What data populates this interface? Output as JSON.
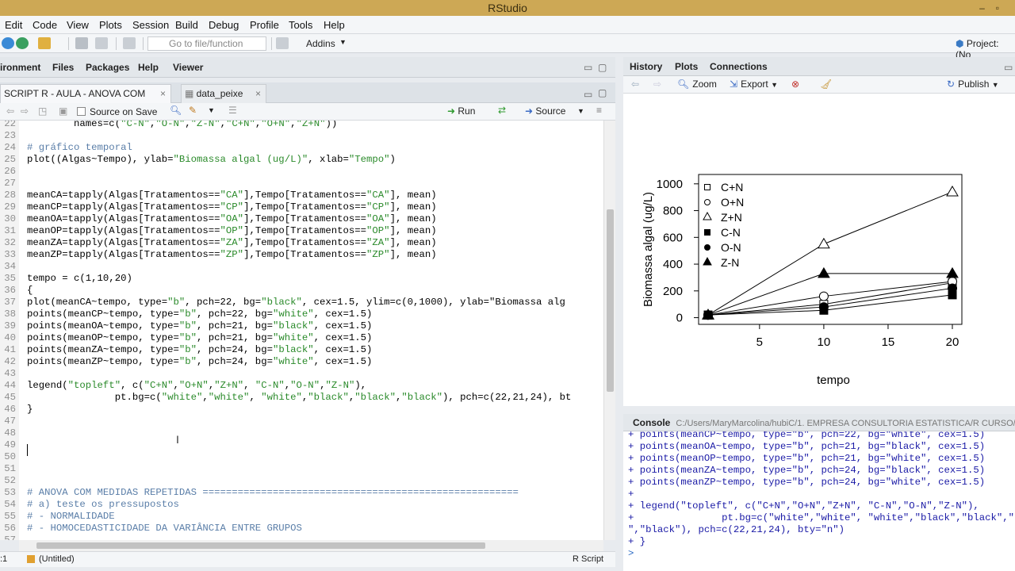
{
  "window": {
    "title": "RStudio"
  },
  "menu": [
    "Edit",
    "Code",
    "View",
    "Plots",
    "Session",
    "Build",
    "Debug",
    "Profile",
    "Tools",
    "Help"
  ],
  "toolbar": {
    "goto_placeholder": "Go to file/function",
    "addins": "Addins",
    "project": "Project: (No"
  },
  "left_pane_tabs": [
    "ironment",
    "Files",
    "Packages",
    "Help",
    "Viewer"
  ],
  "editor_tabs": [
    {
      "label": "SCRIPT R - AULA - ANOVA COM MEDI...",
      "active": true
    },
    {
      "label": "data_peixe",
      "active": false
    }
  ],
  "editor_toolbar": {
    "source_on_save": "Source on Save",
    "run": "Run",
    "source": "Source"
  },
  "code_lines": [
    {
      "n": "22",
      "text": "        names=c(\"C-N\",\"O-N\",\"Z-N\",\"C+N\",\"O+N\",\"Z+N\"))"
    },
    {
      "n": "23",
      "text": ""
    },
    {
      "n": "24",
      "text": "# gráfico temporal"
    },
    {
      "n": "25",
      "text": "plot((Algas~Tempo), ylab=\"Biomassa algal (ug/L)\", xlab=\"Tempo\")"
    },
    {
      "n": "26",
      "text": ""
    },
    {
      "n": "27",
      "text": ""
    },
    {
      "n": "28",
      "text": "meanCA=tapply(Algas[Tratamentos==\"CA\"],Tempo[Tratamentos==\"CA\"], mean)"
    },
    {
      "n": "29",
      "text": "meanCP=tapply(Algas[Tratamentos==\"CP\"],Tempo[Tratamentos==\"CP\"], mean)"
    },
    {
      "n": "30",
      "text": "meanOA=tapply(Algas[Tratamentos==\"OA\"],Tempo[Tratamentos==\"OA\"], mean)"
    },
    {
      "n": "31",
      "text": "meanOP=tapply(Algas[Tratamentos==\"OP\"],Tempo[Tratamentos==\"OP\"], mean)"
    },
    {
      "n": "32",
      "text": "meanZA=tapply(Algas[Tratamentos==\"ZA\"],Tempo[Tratamentos==\"ZA\"], mean)"
    },
    {
      "n": "33",
      "text": "meanZP=tapply(Algas[Tratamentos==\"ZP\"],Tempo[Tratamentos==\"ZP\"], mean)"
    },
    {
      "n": "34",
      "text": ""
    },
    {
      "n": "35",
      "text": "tempo = c(1,10,20)"
    },
    {
      "n": "36",
      "text": "{"
    },
    {
      "n": "37",
      "text": "plot(meanCA~tempo, type=\"b\", pch=22, bg=\"black\", cex=1.5, ylim=c(0,1000), ylab=\"Biomassa alg"
    },
    {
      "n": "38",
      "text": "points(meanCP~tempo, type=\"b\", pch=22, bg=\"white\", cex=1.5)"
    },
    {
      "n": "39",
      "text": "points(meanOA~tempo, type=\"b\", pch=21, bg=\"black\", cex=1.5)"
    },
    {
      "n": "40",
      "text": "points(meanOP~tempo, type=\"b\", pch=21, bg=\"white\", cex=1.5)"
    },
    {
      "n": "41",
      "text": "points(meanZA~tempo, type=\"b\", pch=24, bg=\"black\", cex=1.5)"
    },
    {
      "n": "42",
      "text": "points(meanZP~tempo, type=\"b\", pch=24, bg=\"white\", cex=1.5)"
    },
    {
      "n": "43",
      "text": ""
    },
    {
      "n": "44",
      "text": "legend(\"topleft\", c(\"C+N\",\"O+N\",\"Z+N\", \"C-N\",\"O-N\",\"Z-N\"),"
    },
    {
      "n": "45",
      "text": "               pt.bg=c(\"white\",\"white\", \"white\",\"black\",\"black\",\"black\"), pch=c(22,21,24), bt"
    },
    {
      "n": "46",
      "text": "}"
    },
    {
      "n": "47",
      "text": ""
    },
    {
      "n": "48",
      "text": ""
    },
    {
      "n": "49",
      "text": ""
    },
    {
      "n": "50",
      "text": ""
    },
    {
      "n": "51",
      "text": ""
    },
    {
      "n": "52",
      "text": ""
    },
    {
      "n": "53",
      "text": "# ANOVA COM MEDIDAS REPETIDAS ======================================================"
    },
    {
      "n": "54",
      "text": "# a) teste os pressupostos"
    },
    {
      "n": "55",
      "text": "# - NORMALIDADE"
    },
    {
      "n": "56",
      "text": "# - HOMOCEDASTICIDADE DA VARIÂNCIA ENTRE GRUPOS"
    },
    {
      "n": "57",
      "text": ""
    }
  ],
  "statusbar": {
    "position": ":1",
    "scope": "(Untitled)",
    "filetype": "R Script"
  },
  "right_tabs": [
    "History",
    "Plots",
    "Connections"
  ],
  "plots_toolbar": {
    "zoom": "Zoom",
    "export": "Export",
    "publish": "Publish"
  },
  "chart_data": {
    "type": "line",
    "xlabel": "tempo",
    "ylabel": "Biomassa algal (ug/L)",
    "xlim": [
      1,
      20
    ],
    "ylim": [
      0,
      1000
    ],
    "xticks": [
      5,
      10,
      15,
      20
    ],
    "yticks": [
      0,
      200,
      400,
      600,
      800,
      1000
    ],
    "x": [
      1,
      10,
      20
    ],
    "legend_position": "top-left",
    "series": [
      {
        "name": "C+N",
        "marker": "square-open",
        "values": [
          20,
          100,
          260
        ]
      },
      {
        "name": "O+N",
        "marker": "circle-open",
        "values": [
          20,
          160,
          270
        ]
      },
      {
        "name": "Z+N",
        "marker": "triangle-open",
        "values": [
          20,
          550,
          940
        ]
      },
      {
        "name": "C-N",
        "marker": "square-filled",
        "values": [
          20,
          55,
          170
        ]
      },
      {
        "name": "O-N",
        "marker": "circle-filled",
        "values": [
          20,
          80,
          220
        ]
      },
      {
        "name": "Z-N",
        "marker": "triangle-filled",
        "values": [
          20,
          330,
          330
        ]
      }
    ]
  },
  "console": {
    "label": "Console",
    "path": "C:/Users/MaryMarcolina/hubiC/1. EMPRESA CONSULTORIA ESTATISTICA/R CURSO/",
    "lines": [
      "+ points(meanCP~tempo, type=\"b\", pch=22, bg=\"white\", cex=1.5)",
      "+ points(meanOA~tempo, type=\"b\", pch=21, bg=\"black\", cex=1.5)",
      "+ points(meanOP~tempo, type=\"b\", pch=21, bg=\"white\", cex=1.5)",
      "+ points(meanZA~tempo, type=\"b\", pch=24, bg=\"black\", cex=1.5)",
      "+ points(meanZP~tempo, type=\"b\", pch=24, bg=\"white\", cex=1.5)",
      "+",
      "+ legend(\"topleft\", c(\"C+N\",\"O+N\",\"Z+N\", \"C-N\",\"O-N\",\"Z-N\"),",
      "+               pt.bg=c(\"white\",\"white\", \"white\",\"black\",\"black\",\"blac",
      "\",\"black\"), pch=c(22,21,24), bty=\"n\")",
      "+ }",
      ">"
    ]
  }
}
